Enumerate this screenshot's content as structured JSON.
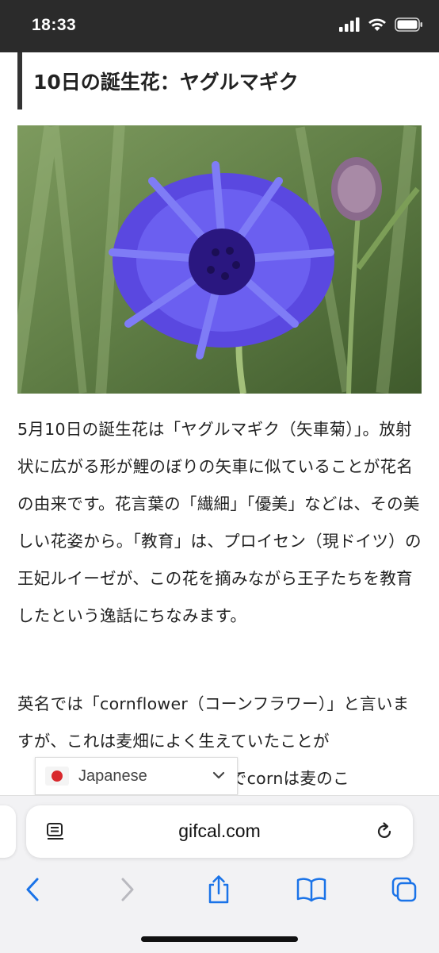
{
  "status_bar": {
    "time": "18:33"
  },
  "article": {
    "heading": "10日の誕生花：ヤグルマギク",
    "paragraph1": "5月10日の誕生花は「ヤグルマギク（矢車菊）」。放射状に広がる形が鯉のぼりの矢車に似ていることが花名の由来です。花言葉の「繊細」「優美」などは、その美しい花姿から。「教育」は、プロイセン（現ドイツ）の王妃ルイーゼが、この花を摘みながら王子たちを教育したという逸話にちなみます。",
    "paragraph2_visible": "英名では「cornflower（コーンフラワー）」と言いますが、これは麦畑によく生えていたことが",
    "paragraph2_partial_end": "語でcornは麦のこ"
  },
  "language_selector": {
    "selected": "Japanese",
    "flag": "japan-flag"
  },
  "browser": {
    "url": "gifcal.com",
    "icons": [
      "reader-icon",
      "reload-icon",
      "back-icon",
      "forward-icon",
      "share-icon",
      "bookmarks-icon",
      "tabs-icon"
    ]
  },
  "colors": {
    "status_bar_bg": "#2b2b2b",
    "link_blue": "#1a73e8",
    "flag_red": "#d8282c"
  }
}
